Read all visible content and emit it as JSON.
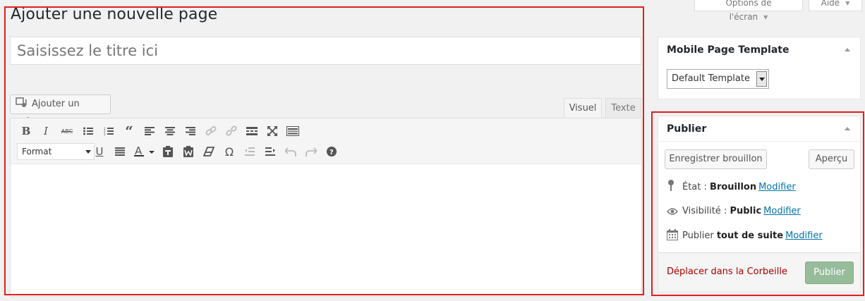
{
  "top_tabs": {
    "screen_options": "Options de l'écran",
    "help": "Aide"
  },
  "page_title": "Ajouter une nouvelle page",
  "title_input": {
    "placeholder": "Saisissez le titre ici",
    "value": ""
  },
  "editor": {
    "add_media_label": "Ajouter un média",
    "tab_visual": "Visuel",
    "tab_text": "Texte",
    "format_select": "Format",
    "toolbar_row1": [
      "bold-icon",
      "italic-icon",
      "strikethrough-icon",
      "bullet-list-icon",
      "numbered-list-icon",
      "blockquote-icon",
      "align-left-icon",
      "align-center-icon",
      "align-right-icon",
      "link-icon",
      "unlink-icon",
      "read-more-icon",
      "fullscreen-icon",
      "toolbar-toggle-icon"
    ],
    "toolbar_row2": [
      "underline-icon",
      "justify-icon",
      "text-color-icon",
      "paste-text-icon",
      "paste-word-icon",
      "clear-format-icon",
      "special-char-icon",
      "outdent-icon",
      "indent-icon",
      "undo-icon",
      "redo-icon",
      "help-icon"
    ]
  },
  "mobile_template": {
    "title": "Mobile Page Template",
    "selected": "Default Template"
  },
  "publish_box": {
    "title": "Publier",
    "save_draft": "Enregistrer brouillon",
    "preview": "Aperçu",
    "status_label": "État :",
    "status_value": "Brouillon",
    "visibility_label": "Visibilité :",
    "visibility_value": "Public",
    "publish_label": "Publier",
    "publish_value": "tout de suite",
    "edit_link": "Modifier",
    "trash": "Déplacer dans la Corbeille",
    "publish_button": "Publier"
  },
  "colors": {
    "highlight": "#e02020",
    "link": "#0073aa",
    "trash": "#aa0000",
    "publish_button": "#97bc9a"
  }
}
